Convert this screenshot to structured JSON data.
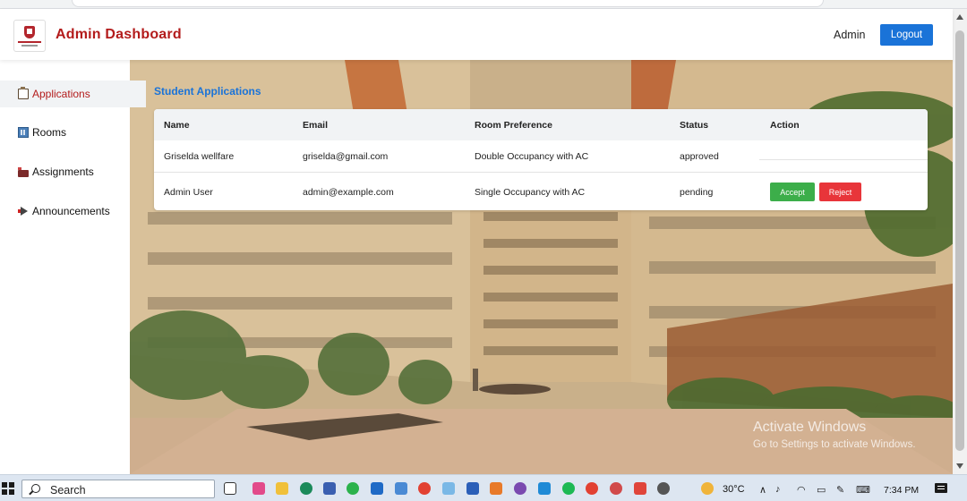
{
  "header": {
    "title": "Admin Dashboard",
    "user_label": "Admin",
    "logout_label": "Logout"
  },
  "sidebar": {
    "items": [
      {
        "label": "Applications",
        "icon": "clipboard-icon",
        "active": true
      },
      {
        "label": "Rooms",
        "icon": "building-icon",
        "active": false
      },
      {
        "label": "Assignments",
        "icon": "bed-icon",
        "active": false
      },
      {
        "label": "Announcements",
        "icon": "megaphone-icon",
        "active": false
      }
    ]
  },
  "main": {
    "section_title": "Student Applications",
    "table": {
      "columns": [
        "Name",
        "Email",
        "Room Preference",
        "Status",
        "Action"
      ],
      "rows": [
        {
          "name": "Griselda wellfare",
          "email": "griselda@gmail.com",
          "room_preference": "Double Occupancy with AC",
          "status": "approved"
        },
        {
          "name": "Admin User",
          "email": "admin@example.com",
          "room_preference": "Single Occupancy with AC",
          "status": "pending",
          "accept_label": "Accept",
          "reject_label": "Reject"
        }
      ]
    }
  },
  "watermark": {
    "line1": "Activate Windows",
    "line2": "Go to Settings to activate Windows."
  },
  "taskbar": {
    "search_placeholder": "Search",
    "temperature": "30°C",
    "time": "7:34 PM"
  },
  "colors": {
    "brand_red": "#b31b1b",
    "accent_blue": "#1a73d8",
    "accept_green": "#3cae4a",
    "reject_red": "#e8353a"
  }
}
